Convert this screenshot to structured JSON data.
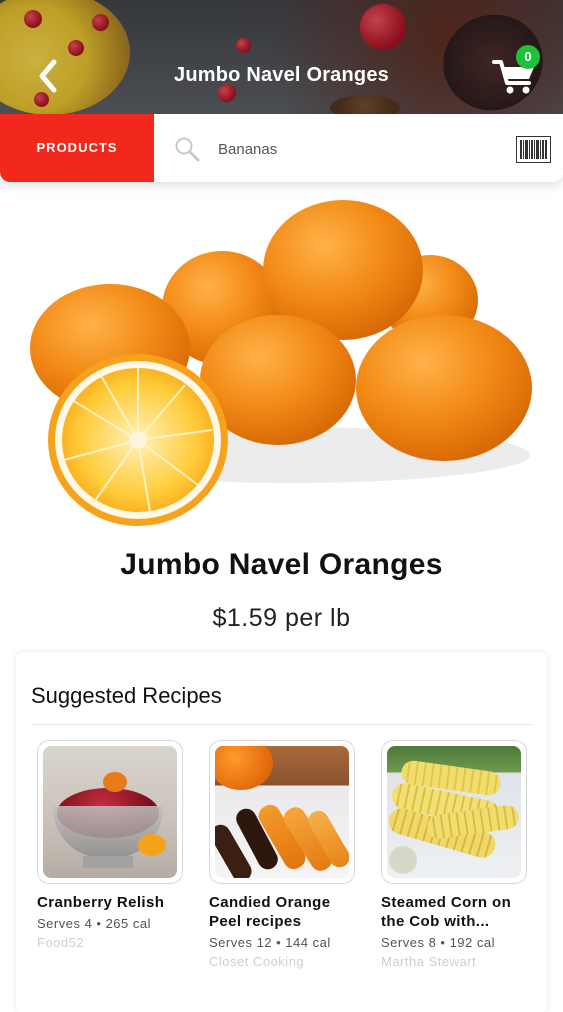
{
  "header": {
    "title": "Jumbo Navel Oranges",
    "cart_count": "0",
    "back_icon": "chevron-left-icon",
    "cart_icon": "shopping-cart-icon"
  },
  "search": {
    "tab_label": "PRODUCTS",
    "placeholder": "Bananas",
    "search_icon": "search-icon",
    "barcode_icon": "barcode-icon"
  },
  "product": {
    "name": "Jumbo Navel Oranges",
    "price": "$1.59 per lb"
  },
  "recipes": {
    "title": "Suggested Recipes",
    "items": [
      {
        "name": "Cranberry Relish",
        "meta": "Serves 4 • 265 cal",
        "source": "Food52"
      },
      {
        "name": "Candied Orange Peel recipes",
        "meta": "Serves 12 • 144 cal",
        "source": "Closet Cooking"
      },
      {
        "name": "Steamed Corn on the Cob with...",
        "meta": "Serves 8 • 192 cal",
        "source": "Martha Stewart"
      }
    ]
  },
  "colors": {
    "accent_red": "#f2281d",
    "badge_green": "#1fc03a",
    "orange": "#f08a1c"
  }
}
